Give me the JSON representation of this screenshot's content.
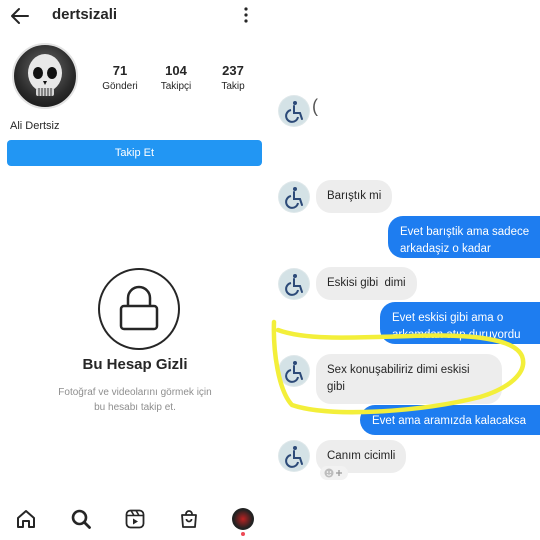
{
  "profile": {
    "username": "dertsizali",
    "full_name": "Ali Dertsiz",
    "stats": [
      {
        "value": "71",
        "label": "Gönderi"
      },
      {
        "value": "104",
        "label": "Takipçi"
      },
      {
        "value": "237",
        "label": "Takip"
      }
    ],
    "follow_button": "Takip Et",
    "private_title": "Bu Hesap Gizli",
    "private_desc_1": "Fotoğraf ve videolarını görmek için",
    "private_desc_2": "bu hesabı takip et."
  },
  "nav": {
    "icons": [
      "home-icon",
      "search-icon",
      "reels-icon",
      "shop-icon",
      "profile-avatar"
    ]
  },
  "chat": {
    "first_incoming_text": "(",
    "messages": [
      {
        "side": "in",
        "text": "Barıştık mi"
      },
      {
        "side": "out",
        "line1": "Evet barıştik ama sadece",
        "line2": "arkadaşiz o kadar"
      },
      {
        "side": "in",
        "text": "Eskisi gibi  dimi"
      },
      {
        "side": "out",
        "line1": "Evet eskisi gibi ama o",
        "line2": "arkamdan atıp duruyordu"
      },
      {
        "side": "in",
        "line1": "Sex konuşabiliriz dimi eskisi",
        "line2": "gibi"
      },
      {
        "side": "out",
        "text": "Evet ama aramızda kalacaksa"
      },
      {
        "side": "in",
        "text": "Canım cicimli"
      }
    ],
    "highlight_color": "#f3ef3a",
    "bubble_out_color": "#1e7df0"
  }
}
